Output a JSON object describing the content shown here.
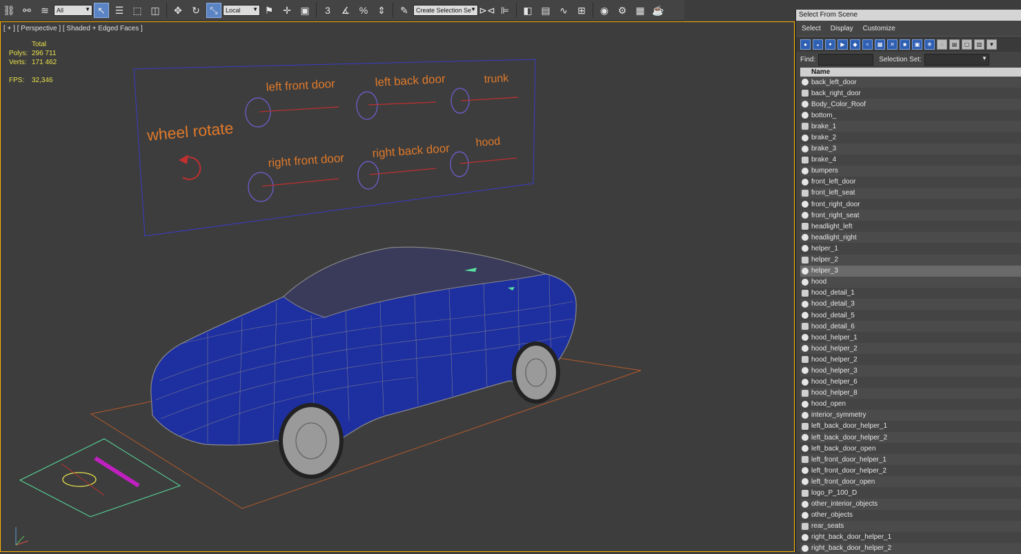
{
  "toolbar": {
    "filter_value": "All",
    "coord_value": "Local",
    "snap_label": "3",
    "selection_set_placeholder": "Create Selection Se"
  },
  "viewport": {
    "label": "[ + ] [ Perspective ] [ Shaded + Edged Faces ]",
    "stats": {
      "header": "Total",
      "polys_label": "Polys:",
      "polys_value": "296 711",
      "verts_label": "Verts:",
      "verts_value": "171 462",
      "fps_label": "FPS:",
      "fps_value": "32,346"
    },
    "board_labels": {
      "wheel_rotate": "wheel rotate",
      "left_front_door": "left front door",
      "left_back_door": "left back door",
      "trunk": "trunk",
      "right_front_door": "right front door",
      "right_back_door": "right back door",
      "hood": "hood"
    },
    "colors": {
      "label": "#e07a2a",
      "circle": "#6f62d8",
      "slider": "#c0302f",
      "board": "#3b3bc8",
      "car_fill": "#1e2fa0",
      "floor": "#b85a2a",
      "helper": "#58e0a0"
    }
  },
  "panel": {
    "title": "Select From Scene",
    "menu": [
      "Select",
      "Display",
      "Customize"
    ],
    "find_label": "Find:",
    "selection_set_label": "Selection Set:",
    "column_name": "Name",
    "items": [
      "back_left_door",
      "back_right_door",
      "Body_Color_Roof",
      "bottom_",
      "brake_1",
      "brake_2",
      "brake_3",
      "brake_4",
      "bumpers",
      "front_left_door",
      "front_left_seat",
      "front_right_door",
      "front_right_seat",
      "headlight_left",
      "headlight_right",
      "helper_1",
      "helper_2",
      "helper_3",
      "hood",
      "hood_detail_1",
      "hood_detail_3",
      "hood_detail_5",
      "hood_detail_6",
      "hood_helper_1",
      "hood_helper_2",
      "hood_helper_2",
      "hood_helper_3",
      "hood_helper_6",
      "hood_helper_8",
      "hood_open",
      "interior_symmetry",
      "left_back_door_helper_1",
      "left_back_door_helper_2",
      "left_back_door_open",
      "left_front_door_helper_1",
      "left_front_door_helper_2",
      "left_front_door_open",
      "logo_P_100_D",
      "other_interior_objects",
      "other_objects",
      "rear_seats",
      "right_back_door_helper_1",
      "right_back_door_helper_2"
    ],
    "selected_item": "helper_3"
  }
}
